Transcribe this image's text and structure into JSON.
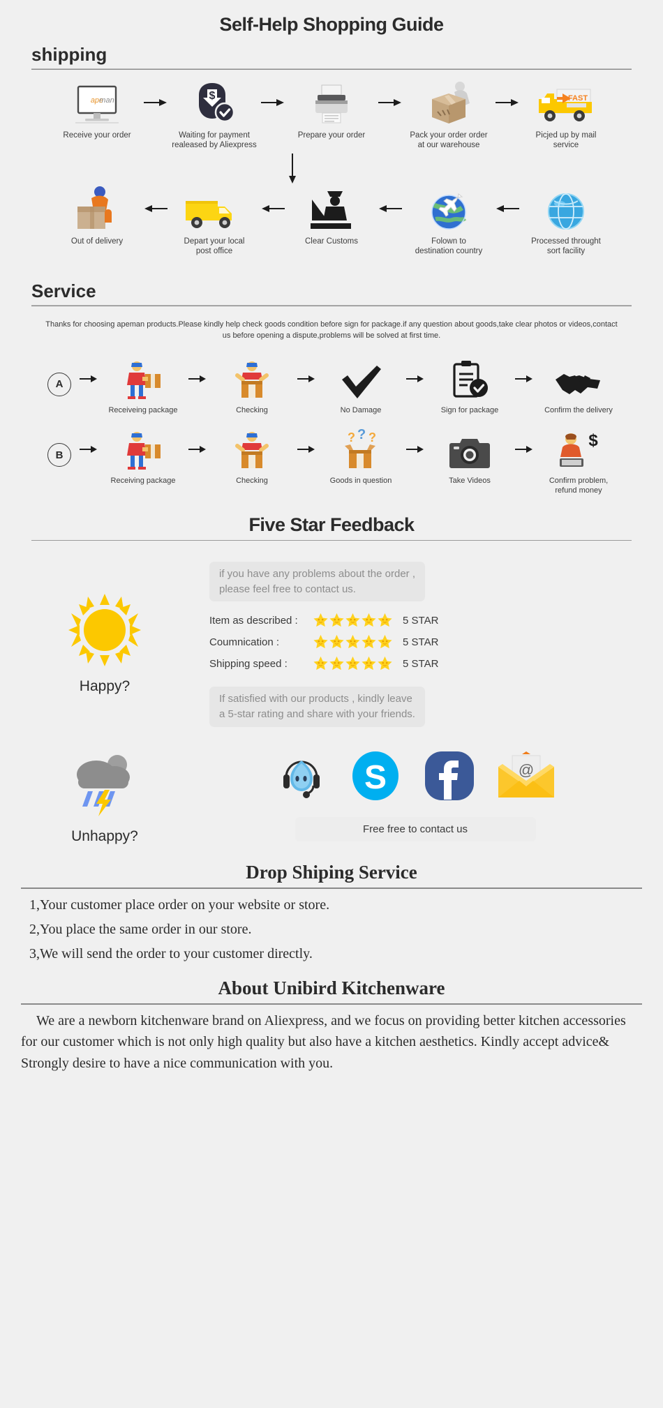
{
  "page_title": "Self-Help Shopping Guide",
  "shipping": {
    "heading": "shipping",
    "row1": [
      {
        "icon": "monitor-apeman-icon",
        "label": "Receive your order"
      },
      {
        "icon": "payment-dollar-check-icon",
        "label": "Waiting for payment\nrealeased by Aliexpress"
      },
      {
        "icon": "printer-icon",
        "label": "Prepare your order"
      },
      {
        "icon": "worker-packing-box-icon",
        "label": "Pack your order order\nat our warehouse"
      },
      {
        "icon": "fast-delivery-truck-icon",
        "label": "Picjed up by mail service"
      }
    ],
    "row2": [
      {
        "icon": "out-for-delivery-courier-icon",
        "label": "Out of delivery"
      },
      {
        "icon": "yellow-post-truck-icon",
        "label": "Depart your local\npost office"
      },
      {
        "icon": "customs-officer-icon",
        "label": "Clear Customs"
      },
      {
        "icon": "globe-plane-icon",
        "label": "Folown to\ndestination country"
      },
      {
        "icon": "blue-globe-icon",
        "label": "Processed throught\nsort facility"
      }
    ]
  },
  "service": {
    "heading": "Service",
    "note": "Thanks for choosing apeman products.Please kindly help check goods condition before sign for package.if any question about goods,take clear photos or videos,contact us before opening a dispute,problems will be solved at first time.",
    "rowA": {
      "badge": "A",
      "steps": [
        {
          "icon": "courier-handing-package-icon",
          "label": "Receiveing package"
        },
        {
          "icon": "person-opening-box-icon",
          "label": "Checking"
        },
        {
          "icon": "checkmark-icon",
          "label": "No Damage"
        },
        {
          "icon": "clipboard-sign-icon",
          "label": "Sign for package"
        },
        {
          "icon": "handshake-icon",
          "label": "Confirm the delivery"
        }
      ]
    },
    "rowB": {
      "badge": "B",
      "steps": [
        {
          "icon": "courier-handing-package-icon",
          "label": "Receiving package"
        },
        {
          "icon": "person-opening-box-icon",
          "label": "Checking"
        },
        {
          "icon": "question-marks-box-icon",
          "label": "Goods in question"
        },
        {
          "icon": "camera-icon",
          "label": "Take Videos"
        },
        {
          "icon": "agent-refund-dollar-icon",
          "label": "Confirm problem,\nrefund money"
        }
      ]
    }
  },
  "feedback": {
    "heading": "Five Star Feedback",
    "problem_bubble": "if you have any problems about the order ,\nplease feel free to contact us.",
    "happy_label": "Happy?",
    "unhappy_label": "Unhappy?",
    "ratings": [
      {
        "label": "Item as described :",
        "stars": 5,
        "value": "5 STAR"
      },
      {
        "label": "Coumnication :",
        "stars": 5,
        "value": "5 STAR"
      },
      {
        "label": "Shipping speed :",
        "stars": 5,
        "value": "5 STAR"
      }
    ],
    "satisfied_bubble": "If satisfied with our products ,  kindly leave\na 5-star rating and share with your friends.",
    "social": [
      {
        "icon": "aliwangwang-support-icon",
        "name": "Aliwangwang"
      },
      {
        "icon": "skype-icon",
        "name": "Skype"
      },
      {
        "icon": "facebook-icon",
        "name": "Facebook"
      },
      {
        "icon": "email-envelope-icon",
        "name": "Email"
      }
    ],
    "contact_bar": "Free free to contact us"
  },
  "dropshipping": {
    "heading": "Drop Shiping Service",
    "lines": [
      "1,Your customer place order on your website or store.",
      "2,You place the same order in our store.",
      "3,We will send the order to your customer directly."
    ]
  },
  "about": {
    "heading": "About Unibird Kitchenware",
    "paragraph": "We are a newborn kitchenware brand on Aliexpress, and we focus on providing better kitchen accessories for our customer which is not only high quality but also have a kitchen aesthetics. Kindly accept advice& Strongly desire to have a nice communication with you."
  },
  "colors": {
    "background": "#f0f0f0",
    "text": "#2b2b2b",
    "rule": "#8a8a8a",
    "bubble_bg": "#e6e6e6",
    "bubble_text": "#8d8d8d",
    "star": "#ffd21e",
    "sun": "#fcc800",
    "skype": "#00aff0",
    "facebook": "#3b5998",
    "envelope": "#f9c335"
  }
}
